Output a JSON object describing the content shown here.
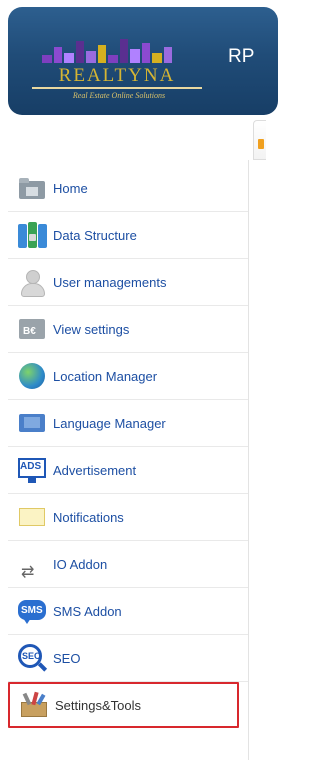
{
  "header": {
    "logo_text": "REALTYNA",
    "logo_subtitle": "Real Estate Online Solutions",
    "title_fragment": "RP"
  },
  "sidebar": {
    "items": [
      {
        "label": "Home",
        "icon": "home-icon"
      },
      {
        "label": "Data Structure",
        "icon": "data-structure-icon"
      },
      {
        "label": "User managements",
        "icon": "user-icon"
      },
      {
        "label": "View settings",
        "icon": "view-settings-icon"
      },
      {
        "label": "Location Manager",
        "icon": "globe-icon"
      },
      {
        "label": "Language Manager",
        "icon": "flag-icon"
      },
      {
        "label": "Advertisement",
        "icon": "ads-icon"
      },
      {
        "label": "Notifications",
        "icon": "envelope-icon"
      },
      {
        "label": "IO Addon",
        "icon": "shuffle-icon"
      },
      {
        "label": "SMS Addon",
        "icon": "sms-icon"
      },
      {
        "label": "SEO",
        "icon": "seo-icon"
      },
      {
        "label": "Settings&Tools",
        "icon": "toolbox-icon",
        "selected": true
      }
    ],
    "ads_icon_text": "ADS",
    "sms_icon_text": "SMS",
    "seo_icon_text": "SEO",
    "view_icon_text": "B€"
  },
  "colors": {
    "header_bg": "#204c78",
    "logo_gold": "#d6b533",
    "link_blue": "#1d4fa3",
    "selected_border": "#d8282d"
  }
}
